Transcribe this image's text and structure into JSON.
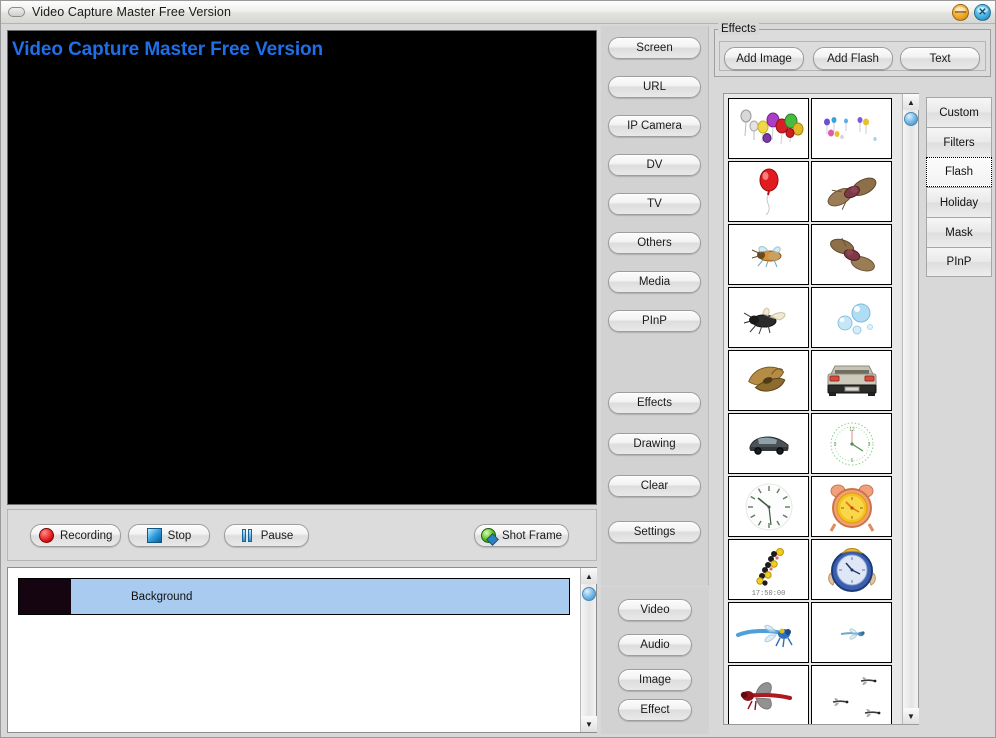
{
  "window": {
    "title": "Video Capture Master Free Version",
    "icon": "window-pill-icon",
    "minimize_label": "—",
    "close_label": "✕"
  },
  "preview": {
    "watermark": "Video Capture Master Free Version",
    "background_color": "#000000",
    "text_color": "#1f6fe8"
  },
  "recording_bar": {
    "buttons": [
      {
        "label": "Recording",
        "icon": "record-circle-icon"
      },
      {
        "label": "Stop",
        "icon": "stop-square-icon"
      },
      {
        "label": "Pause",
        "icon": "pause-bars-icon"
      },
      {
        "label": "Shot Frame",
        "icon": "magnifier-icon"
      }
    ]
  },
  "sources": {
    "buttons": [
      {
        "label": "Screen"
      },
      {
        "label": "URL"
      },
      {
        "label": "IP Camera"
      },
      {
        "label": "DV"
      },
      {
        "label": "TV"
      },
      {
        "label": "Others"
      },
      {
        "label": "Media"
      },
      {
        "label": "PInP"
      }
    ],
    "tools": [
      {
        "label": "Effects"
      },
      {
        "label": "Drawing"
      },
      {
        "label": "Clear"
      },
      {
        "label": "Settings"
      }
    ]
  },
  "track_tools": {
    "buttons": [
      {
        "label": "Video"
      },
      {
        "label": "Audio"
      },
      {
        "label": "Image"
      },
      {
        "label": "Effect"
      }
    ]
  },
  "timeline": {
    "rows": [
      {
        "name": "Background",
        "selected": true,
        "thumb_color": "#150510"
      }
    ]
  },
  "effects": {
    "group_title": "Effects",
    "buttons": [
      {
        "label": "Add Image"
      },
      {
        "label": "Add Flash"
      },
      {
        "label": "Text"
      }
    ],
    "categories": [
      {
        "label": "Custom",
        "selected": false
      },
      {
        "label": "Filters",
        "selected": false
      },
      {
        "label": "Flash",
        "selected": true
      },
      {
        "label": "Holiday",
        "selected": false
      },
      {
        "label": "Mask",
        "selected": false
      },
      {
        "label": "PInP",
        "selected": false
      }
    ],
    "thumbnails": [
      {
        "name": "balloons-cluster",
        "kind": "balloons-many"
      },
      {
        "name": "balloons-small",
        "kind": "balloons-small"
      },
      {
        "name": "red-balloon",
        "kind": "red-balloon"
      },
      {
        "name": "moth-brown",
        "kind": "moth"
      },
      {
        "name": "bee-flying",
        "kind": "bee"
      },
      {
        "name": "moth-brown-2",
        "kind": "moth2"
      },
      {
        "name": "bee-dark",
        "kind": "bee-dark"
      },
      {
        "name": "bubbles-blue",
        "kind": "bubbles"
      },
      {
        "name": "butterfly-wing",
        "kind": "butterfly"
      },
      {
        "name": "car-rear-silver",
        "kind": "car-rear"
      },
      {
        "name": "car-side-dark",
        "kind": "car-side"
      },
      {
        "name": "compass-clock-green",
        "kind": "compass-clock"
      },
      {
        "name": "wall-clock",
        "kind": "wall-clock"
      },
      {
        "name": "alarm-clock-orange",
        "kind": "alarm-clock"
      },
      {
        "name": "digital-time-beads",
        "kind": "beads-time",
        "label": "17:50:00"
      },
      {
        "name": "clock-blue-hands",
        "kind": "clock-blue"
      },
      {
        "name": "dragonfly-blue",
        "kind": "dragonfly-blue"
      },
      {
        "name": "dragonfly-small",
        "kind": "dragonfly-small"
      },
      {
        "name": "dragonfly-red",
        "kind": "dragonfly-red"
      },
      {
        "name": "dragonflies-trio",
        "kind": "dragonflies-trio"
      }
    ]
  },
  "scrollbars": {
    "up_arrow": "▲",
    "down_arrow": "▼"
  }
}
